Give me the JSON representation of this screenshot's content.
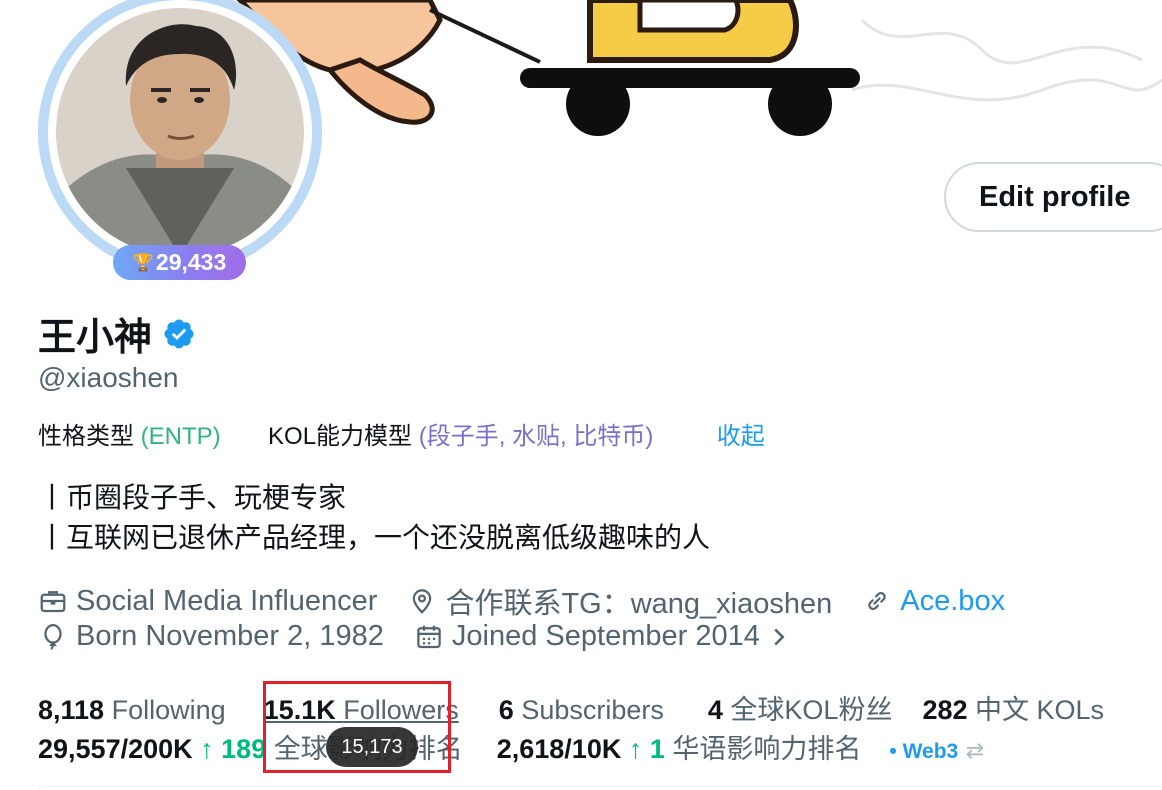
{
  "profile": {
    "score": "29,433",
    "name": "王小神",
    "handle": "@xiaoshen"
  },
  "actions": {
    "edit_profile": "Edit profile"
  },
  "tags": {
    "personality_label": "性格类型",
    "personality_value": "(ENTP)",
    "kol_label": "KOL能力模型",
    "kol_value": "(段子手, 水贴, 比特币)",
    "collapse": "收起"
  },
  "bio": {
    "line1": "丨币圈段子手、玩梗专家",
    "line2": "丨互联网已退休产品经理，一个还没脱离低级趣味的人"
  },
  "meta": {
    "job": "Social Media Influencer",
    "location": "合作联系TG：wang_xiaoshen",
    "link": "Ace.box",
    "born": "Born November 2, 1982",
    "joined": "Joined September 2014"
  },
  "stats": {
    "following_count": "8,118",
    "following_label": "Following",
    "followers_count": "15.1K",
    "followers_label": "Followers",
    "subscribers_count": "6",
    "subscribers_label": "Subscribers",
    "global_kol_count": "4",
    "global_kol_label": "全球KOL粉丝",
    "cn_kol_count": "282",
    "cn_kol_label": "中文 KOLs",
    "global_rank": "29,557/200K",
    "global_rank_change": "↑ 189",
    "global_rank_label": "全球影响力排名",
    "cn_rank": "2,618/10K",
    "cn_rank_change": "↑ 1",
    "cn_rank_label": "华语影响力排名",
    "web3": "• Web3",
    "swap": "⇄"
  },
  "tooltip": {
    "followers_exact": "15,173"
  },
  "colors": {
    "accent": "#1d9bf0",
    "up": "#00ba7c",
    "highlight": "#e0202a"
  }
}
